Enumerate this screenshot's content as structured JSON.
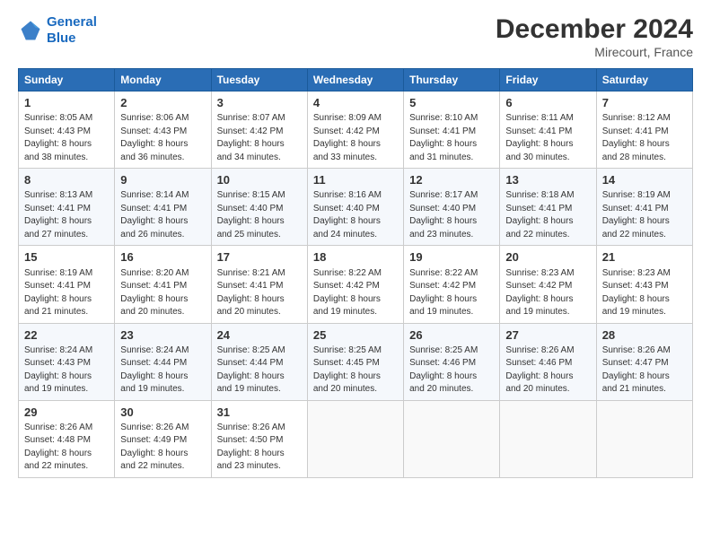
{
  "header": {
    "logo_line1": "General",
    "logo_line2": "Blue",
    "month_title": "December 2024",
    "location": "Mirecourt, France"
  },
  "days_of_week": [
    "Sunday",
    "Monday",
    "Tuesday",
    "Wednesday",
    "Thursday",
    "Friday",
    "Saturday"
  ],
  "weeks": [
    [
      {
        "day": "1",
        "content": "Sunrise: 8:05 AM\nSunset: 4:43 PM\nDaylight: 8 hours\nand 38 minutes."
      },
      {
        "day": "2",
        "content": "Sunrise: 8:06 AM\nSunset: 4:43 PM\nDaylight: 8 hours\nand 36 minutes."
      },
      {
        "day": "3",
        "content": "Sunrise: 8:07 AM\nSunset: 4:42 PM\nDaylight: 8 hours\nand 34 minutes."
      },
      {
        "day": "4",
        "content": "Sunrise: 8:09 AM\nSunset: 4:42 PM\nDaylight: 8 hours\nand 33 minutes."
      },
      {
        "day": "5",
        "content": "Sunrise: 8:10 AM\nSunset: 4:41 PM\nDaylight: 8 hours\nand 31 minutes."
      },
      {
        "day": "6",
        "content": "Sunrise: 8:11 AM\nSunset: 4:41 PM\nDaylight: 8 hours\nand 30 minutes."
      },
      {
        "day": "7",
        "content": "Sunrise: 8:12 AM\nSunset: 4:41 PM\nDaylight: 8 hours\nand 28 minutes."
      }
    ],
    [
      {
        "day": "8",
        "content": "Sunrise: 8:13 AM\nSunset: 4:41 PM\nDaylight: 8 hours\nand 27 minutes."
      },
      {
        "day": "9",
        "content": "Sunrise: 8:14 AM\nSunset: 4:41 PM\nDaylight: 8 hours\nand 26 minutes."
      },
      {
        "day": "10",
        "content": "Sunrise: 8:15 AM\nSunset: 4:40 PM\nDaylight: 8 hours\nand 25 minutes."
      },
      {
        "day": "11",
        "content": "Sunrise: 8:16 AM\nSunset: 4:40 PM\nDaylight: 8 hours\nand 24 minutes."
      },
      {
        "day": "12",
        "content": "Sunrise: 8:17 AM\nSunset: 4:40 PM\nDaylight: 8 hours\nand 23 minutes."
      },
      {
        "day": "13",
        "content": "Sunrise: 8:18 AM\nSunset: 4:41 PM\nDaylight: 8 hours\nand 22 minutes."
      },
      {
        "day": "14",
        "content": "Sunrise: 8:19 AM\nSunset: 4:41 PM\nDaylight: 8 hours\nand 22 minutes."
      }
    ],
    [
      {
        "day": "15",
        "content": "Sunrise: 8:19 AM\nSunset: 4:41 PM\nDaylight: 8 hours\nand 21 minutes."
      },
      {
        "day": "16",
        "content": "Sunrise: 8:20 AM\nSunset: 4:41 PM\nDaylight: 8 hours\nand 20 minutes."
      },
      {
        "day": "17",
        "content": "Sunrise: 8:21 AM\nSunset: 4:41 PM\nDaylight: 8 hours\nand 20 minutes."
      },
      {
        "day": "18",
        "content": "Sunrise: 8:22 AM\nSunset: 4:42 PM\nDaylight: 8 hours\nand 19 minutes."
      },
      {
        "day": "19",
        "content": "Sunrise: 8:22 AM\nSunset: 4:42 PM\nDaylight: 8 hours\nand 19 minutes."
      },
      {
        "day": "20",
        "content": "Sunrise: 8:23 AM\nSunset: 4:42 PM\nDaylight: 8 hours\nand 19 minutes."
      },
      {
        "day": "21",
        "content": "Sunrise: 8:23 AM\nSunset: 4:43 PM\nDaylight: 8 hours\nand 19 minutes."
      }
    ],
    [
      {
        "day": "22",
        "content": "Sunrise: 8:24 AM\nSunset: 4:43 PM\nDaylight: 8 hours\nand 19 minutes."
      },
      {
        "day": "23",
        "content": "Sunrise: 8:24 AM\nSunset: 4:44 PM\nDaylight: 8 hours\nand 19 minutes."
      },
      {
        "day": "24",
        "content": "Sunrise: 8:25 AM\nSunset: 4:44 PM\nDaylight: 8 hours\nand 19 minutes."
      },
      {
        "day": "25",
        "content": "Sunrise: 8:25 AM\nSunset: 4:45 PM\nDaylight: 8 hours\nand 20 minutes."
      },
      {
        "day": "26",
        "content": "Sunrise: 8:25 AM\nSunset: 4:46 PM\nDaylight: 8 hours\nand 20 minutes."
      },
      {
        "day": "27",
        "content": "Sunrise: 8:26 AM\nSunset: 4:46 PM\nDaylight: 8 hours\nand 20 minutes."
      },
      {
        "day": "28",
        "content": "Sunrise: 8:26 AM\nSunset: 4:47 PM\nDaylight: 8 hours\nand 21 minutes."
      }
    ],
    [
      {
        "day": "29",
        "content": "Sunrise: 8:26 AM\nSunset: 4:48 PM\nDaylight: 8 hours\nand 22 minutes."
      },
      {
        "day": "30",
        "content": "Sunrise: 8:26 AM\nSunset: 4:49 PM\nDaylight: 8 hours\nand 22 minutes."
      },
      {
        "day": "31",
        "content": "Sunrise: 8:26 AM\nSunset: 4:50 PM\nDaylight: 8 hours\nand 23 minutes."
      },
      {
        "day": "",
        "content": ""
      },
      {
        "day": "",
        "content": ""
      },
      {
        "day": "",
        "content": ""
      },
      {
        "day": "",
        "content": ""
      }
    ]
  ]
}
